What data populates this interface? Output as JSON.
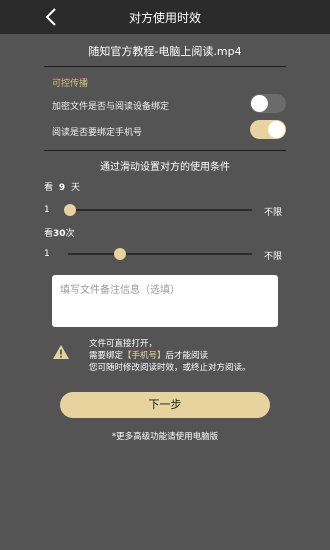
{
  "nav": {
    "title": "对方使用时效"
  },
  "file": {
    "name": "随知官方教程-电脑上阅读.mp4"
  },
  "spread": {
    "section_label": "可控传播",
    "bind_device_label": "加密文件是否与阅读设备绑定",
    "bind_device_on": false,
    "bind_phone_label": "阅读是否要绑定手机号",
    "bind_phone_on": true
  },
  "conditions": {
    "title": "通过滑动设置对方的使用条件",
    "days": {
      "prefix": "看",
      "value": "9",
      "suffix": "天",
      "min": "1",
      "max": "不限"
    },
    "times": {
      "prefix": "看",
      "value": "30",
      "suffix": "次",
      "min": "1",
      "max": "不限"
    }
  },
  "note": {
    "placeholder": "填写文件备注信息（选填）"
  },
  "warning": {
    "line1": "文件可直接打开，",
    "line2_prefix": "需要绑定",
    "line2_highlight": "【手机号】",
    "line2_suffix": "后才能阅读",
    "line3": "您可随时修改阅读时效，或终止对方阅读。"
  },
  "actions": {
    "next_label": "下一步"
  },
  "footer": {
    "note": "*更多高级功能请使用电脑版"
  },
  "icons": {
    "back": "chevron-left-icon",
    "warning": "warning-icon"
  },
  "colors": {
    "accent": "#e7d39d",
    "section_label": "#d9c17a",
    "background": "#545454",
    "nav": "#2b2b2b"
  }
}
